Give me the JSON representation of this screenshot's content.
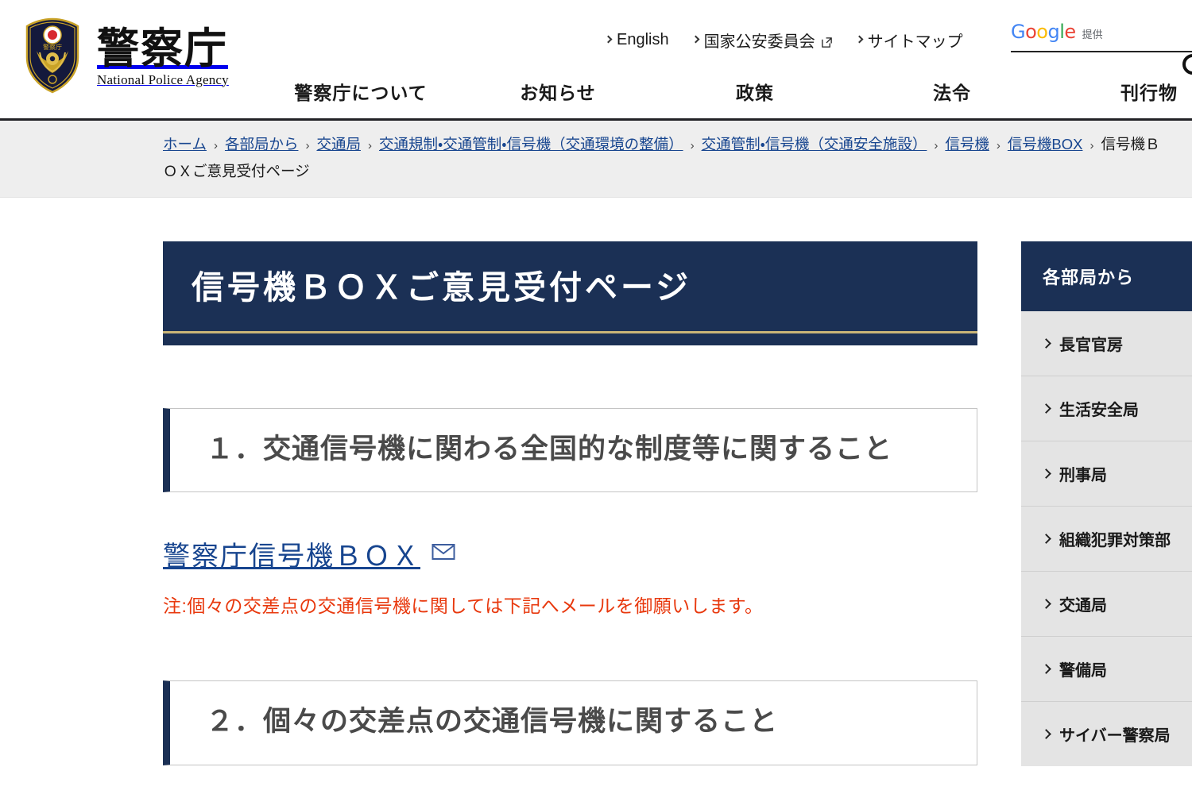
{
  "header": {
    "logo_jp": "警察庁",
    "logo_en": "National Police Agency",
    "utility_links": [
      {
        "label": "English",
        "external": false
      },
      {
        "label": "国家公安委員会",
        "external": true
      },
      {
        "label": "サイトマップ",
        "external": false
      }
    ],
    "search": {
      "google_word": "Google",
      "provided_label": "提供",
      "value": "",
      "placeholder": ""
    },
    "nav": [
      {
        "label": "警察庁について"
      },
      {
        "label": "お知らせ"
      },
      {
        "label": "政策"
      },
      {
        "label": "法令"
      },
      {
        "label": "刊行物"
      }
    ]
  },
  "breadcrumb": {
    "items": [
      {
        "label": "ホーム",
        "link": true
      },
      {
        "label": "各部局から",
        "link": true
      },
      {
        "label": "交通局",
        "link": true
      },
      {
        "label": "交通規制・交通管制・信号機（交通環境の整備）",
        "link": true
      },
      {
        "label": "交通管制・信号機（交通安全施設）",
        "link": true
      },
      {
        "label": "信号機",
        "link": true
      },
      {
        "label": "信号機BOX",
        "link": true
      },
      {
        "label": "信号機ＢＯＸご意見受付ページ",
        "link": false
      }
    ],
    "separator": "›"
  },
  "main": {
    "page_title": "信号機ＢＯＸご意見受付ページ",
    "sections": [
      {
        "heading": "１．交通信号機に関わる全国的な制度等に関すること"
      },
      {
        "heading": "２．個々の交差点の交通信号機に関すること"
      }
    ],
    "mail_link_label": "警察庁信号機ＢＯＸ",
    "note": "注:個々の交差点の交通信号機に関しては下記へメールを御願いします。"
  },
  "sidebar": {
    "title": "各部局から",
    "items": [
      {
        "label": "長官官房"
      },
      {
        "label": "生活安全局"
      },
      {
        "label": "刑事局"
      },
      {
        "label": "組織犯罪対策部"
      },
      {
        "label": "交通局"
      },
      {
        "label": "警備局"
      },
      {
        "label": "サイバー警察局"
      }
    ]
  },
  "colors": {
    "navy": "#1b3055",
    "gold": "#c9b577",
    "link_blue": "#17458f",
    "alert_red": "#e8380d",
    "sidebar_gray": "#e4e4e4",
    "breadcrumb_gray": "#eeeeee"
  }
}
